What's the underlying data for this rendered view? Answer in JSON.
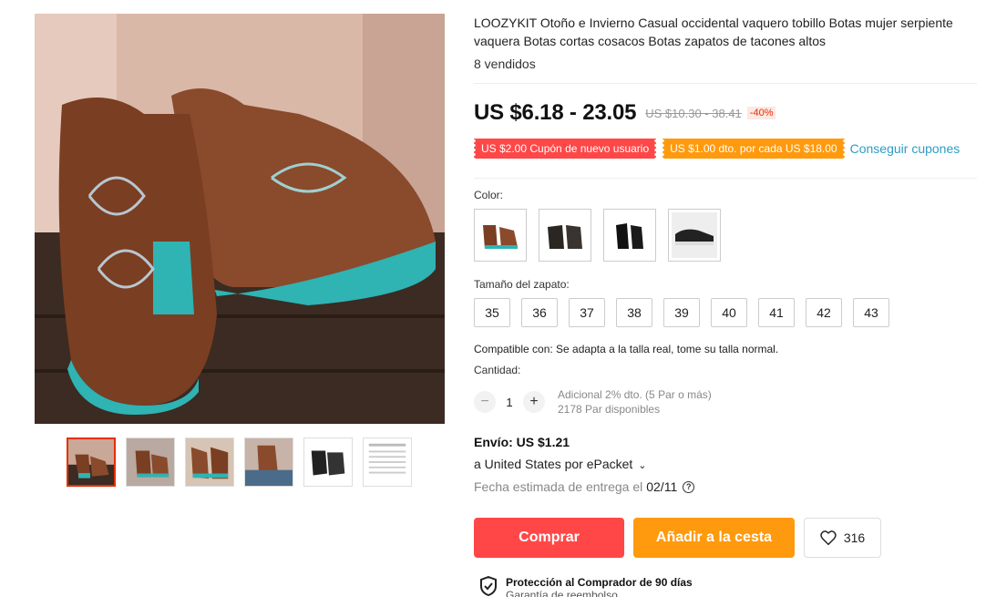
{
  "product": {
    "title": "LOOZYKIT Otoño e Invierno Casual occidental vaquero tobillo Botas mujer serpiente vaquera Botas cortas cosacos Botas zapatos de tacones altos",
    "sold": "8 vendidos",
    "price": "US $6.18 - 23.05",
    "original_price": "US $10.30 - 38.41",
    "discount": "-40%"
  },
  "coupons": {
    "new_user": "US $2.00 Cupón de nuevo usuario",
    "per_spend": "US $1.00 dto. por cada US $18.00",
    "get_link": "Conseguir cupones"
  },
  "color": {
    "label": "Color:",
    "options": [
      "brown-boot",
      "black-studded-boot",
      "black-boot",
      "black-sneaker"
    ]
  },
  "size": {
    "label": "Tamaño del zapato:",
    "options": [
      "35",
      "36",
      "37",
      "38",
      "39",
      "40",
      "41",
      "42",
      "43"
    ]
  },
  "compat_text": "Compatible con: Se adapta a la talla real, tome su talla normal.",
  "quantity": {
    "label": "Cantidad:",
    "value": "1",
    "minus": "−",
    "plus": "+",
    "extra_discount": "Adicional 2% dto. (5 Par o más)",
    "available": "2178 Par disponibles"
  },
  "shipping": {
    "cost": "Envío: US $1.21",
    "to": "a United States por ePacket",
    "delivery_label": "Fecha estimada de entrega el",
    "delivery_date": "02/11"
  },
  "actions": {
    "buy": "Comprar",
    "cart": "Añadir a la cesta",
    "wish_count": "316"
  },
  "protection": {
    "title": "Protección al Comprador de 90 días",
    "subtitle": "Garantía de reembolso"
  },
  "colors": {
    "accent_red": "#ff4747",
    "accent_orange": "#ff9a0e",
    "link_blue": "#2e9cc3"
  }
}
